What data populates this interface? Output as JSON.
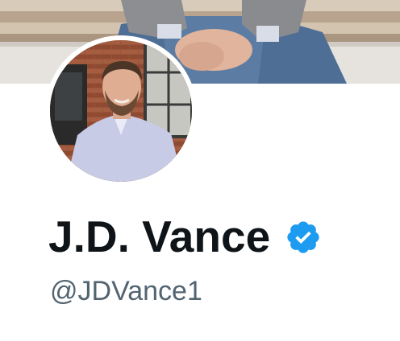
{
  "profile": {
    "display_name": "J.D. Vance",
    "handle": "@JDVance1",
    "verified": true,
    "avatar_icon": "profile-photo",
    "banner_icon": "banner-photo"
  },
  "colors": {
    "name_text": "#0f1419",
    "handle_text": "#536471",
    "verified_badge": "#1d9bf0",
    "background": "#ffffff"
  }
}
